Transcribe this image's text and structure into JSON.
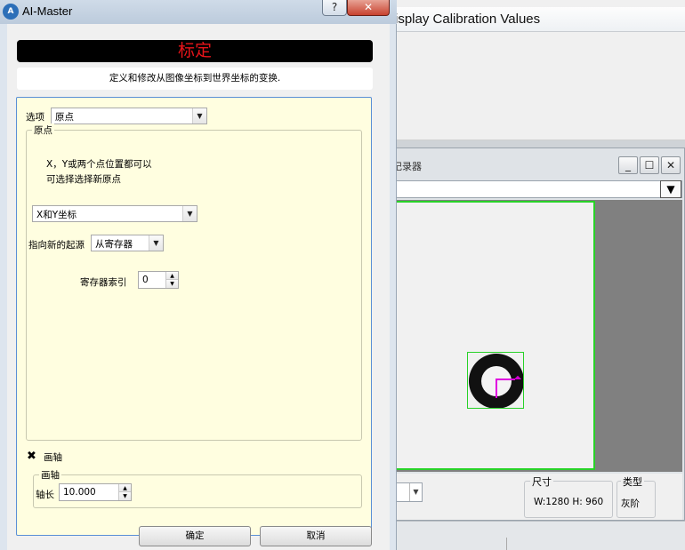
{
  "dialog": {
    "app_title": "AI-Master",
    "logo_text": "A",
    "help_label": "?",
    "close_label": "✕",
    "header_title": "标定",
    "description": "定义和修改从图像坐标到世界坐标的变换.",
    "option_label": "选项",
    "option_value": "原点",
    "origin_group_label": "原点",
    "info_line1": "X，Y或两个点位置都可以",
    "info_line2": "可选择选择新原点",
    "coord_type_value": "X和Y坐标",
    "pointer_label": "指向新的起源",
    "pointer_value": "从寄存器",
    "register_index_label": "寄存器索引",
    "register_index_value": "0",
    "draw_axis_check": "✖",
    "draw_axis_label": "画轴",
    "axis_group_label": "画轴",
    "axis_length_label": "轴长",
    "axis_length_value": "10.000",
    "ok_label": "确定",
    "cancel_label": "取消"
  },
  "background_window": {
    "title": "isplay Calibration Values",
    "recorder_title": "记录器",
    "minimize_label": "_",
    "maximize_label": "☐",
    "close_label": "✕",
    "combo_arrow": "▼",
    "size_group_label": "尺寸",
    "size_value": "W:1280  H: 960",
    "type_group_label": "类型",
    "type_value": "灰阶"
  },
  "colors": {
    "header_text": "#e8141a",
    "panel_bg": "#fffee0",
    "roi_green": "#28d228",
    "axis_magenta": "#e000e0"
  }
}
